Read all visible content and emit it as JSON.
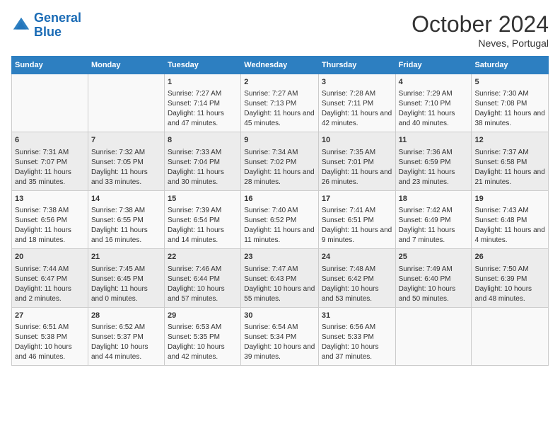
{
  "header": {
    "logo_line1": "General",
    "logo_line2": "Blue",
    "month": "October 2024",
    "location": "Neves, Portugal"
  },
  "weekdays": [
    "Sunday",
    "Monday",
    "Tuesday",
    "Wednesday",
    "Thursday",
    "Friday",
    "Saturday"
  ],
  "weeks": [
    [
      {
        "day": "",
        "content": ""
      },
      {
        "day": "",
        "content": ""
      },
      {
        "day": "1",
        "content": "Sunrise: 7:27 AM\nSunset: 7:14 PM\nDaylight: 11 hours and 47 minutes."
      },
      {
        "day": "2",
        "content": "Sunrise: 7:27 AM\nSunset: 7:13 PM\nDaylight: 11 hours and 45 minutes."
      },
      {
        "day": "3",
        "content": "Sunrise: 7:28 AM\nSunset: 7:11 PM\nDaylight: 11 hours and 42 minutes."
      },
      {
        "day": "4",
        "content": "Sunrise: 7:29 AM\nSunset: 7:10 PM\nDaylight: 11 hours and 40 minutes."
      },
      {
        "day": "5",
        "content": "Sunrise: 7:30 AM\nSunset: 7:08 PM\nDaylight: 11 hours and 38 minutes."
      }
    ],
    [
      {
        "day": "6",
        "content": "Sunrise: 7:31 AM\nSunset: 7:07 PM\nDaylight: 11 hours and 35 minutes."
      },
      {
        "day": "7",
        "content": "Sunrise: 7:32 AM\nSunset: 7:05 PM\nDaylight: 11 hours and 33 minutes."
      },
      {
        "day": "8",
        "content": "Sunrise: 7:33 AM\nSunset: 7:04 PM\nDaylight: 11 hours and 30 minutes."
      },
      {
        "day": "9",
        "content": "Sunrise: 7:34 AM\nSunset: 7:02 PM\nDaylight: 11 hours and 28 minutes."
      },
      {
        "day": "10",
        "content": "Sunrise: 7:35 AM\nSunset: 7:01 PM\nDaylight: 11 hours and 26 minutes."
      },
      {
        "day": "11",
        "content": "Sunrise: 7:36 AM\nSunset: 6:59 PM\nDaylight: 11 hours and 23 minutes."
      },
      {
        "day": "12",
        "content": "Sunrise: 7:37 AM\nSunset: 6:58 PM\nDaylight: 11 hours and 21 minutes."
      }
    ],
    [
      {
        "day": "13",
        "content": "Sunrise: 7:38 AM\nSunset: 6:56 PM\nDaylight: 11 hours and 18 minutes."
      },
      {
        "day": "14",
        "content": "Sunrise: 7:38 AM\nSunset: 6:55 PM\nDaylight: 11 hours and 16 minutes."
      },
      {
        "day": "15",
        "content": "Sunrise: 7:39 AM\nSunset: 6:54 PM\nDaylight: 11 hours and 14 minutes."
      },
      {
        "day": "16",
        "content": "Sunrise: 7:40 AM\nSunset: 6:52 PM\nDaylight: 11 hours and 11 minutes."
      },
      {
        "day": "17",
        "content": "Sunrise: 7:41 AM\nSunset: 6:51 PM\nDaylight: 11 hours and 9 minutes."
      },
      {
        "day": "18",
        "content": "Sunrise: 7:42 AM\nSunset: 6:49 PM\nDaylight: 11 hours and 7 minutes."
      },
      {
        "day": "19",
        "content": "Sunrise: 7:43 AM\nSunset: 6:48 PM\nDaylight: 11 hours and 4 minutes."
      }
    ],
    [
      {
        "day": "20",
        "content": "Sunrise: 7:44 AM\nSunset: 6:47 PM\nDaylight: 11 hours and 2 minutes."
      },
      {
        "day": "21",
        "content": "Sunrise: 7:45 AM\nSunset: 6:45 PM\nDaylight: 11 hours and 0 minutes."
      },
      {
        "day": "22",
        "content": "Sunrise: 7:46 AM\nSunset: 6:44 PM\nDaylight: 10 hours and 57 minutes."
      },
      {
        "day": "23",
        "content": "Sunrise: 7:47 AM\nSunset: 6:43 PM\nDaylight: 10 hours and 55 minutes."
      },
      {
        "day": "24",
        "content": "Sunrise: 7:48 AM\nSunset: 6:42 PM\nDaylight: 10 hours and 53 minutes."
      },
      {
        "day": "25",
        "content": "Sunrise: 7:49 AM\nSunset: 6:40 PM\nDaylight: 10 hours and 50 minutes."
      },
      {
        "day": "26",
        "content": "Sunrise: 7:50 AM\nSunset: 6:39 PM\nDaylight: 10 hours and 48 minutes."
      }
    ],
    [
      {
        "day": "27",
        "content": "Sunrise: 6:51 AM\nSunset: 5:38 PM\nDaylight: 10 hours and 46 minutes."
      },
      {
        "day": "28",
        "content": "Sunrise: 6:52 AM\nSunset: 5:37 PM\nDaylight: 10 hours and 44 minutes."
      },
      {
        "day": "29",
        "content": "Sunrise: 6:53 AM\nSunset: 5:35 PM\nDaylight: 10 hours and 42 minutes."
      },
      {
        "day": "30",
        "content": "Sunrise: 6:54 AM\nSunset: 5:34 PM\nDaylight: 10 hours and 39 minutes."
      },
      {
        "day": "31",
        "content": "Sunrise: 6:56 AM\nSunset: 5:33 PM\nDaylight: 10 hours and 37 minutes."
      },
      {
        "day": "",
        "content": ""
      },
      {
        "day": "",
        "content": ""
      }
    ]
  ]
}
